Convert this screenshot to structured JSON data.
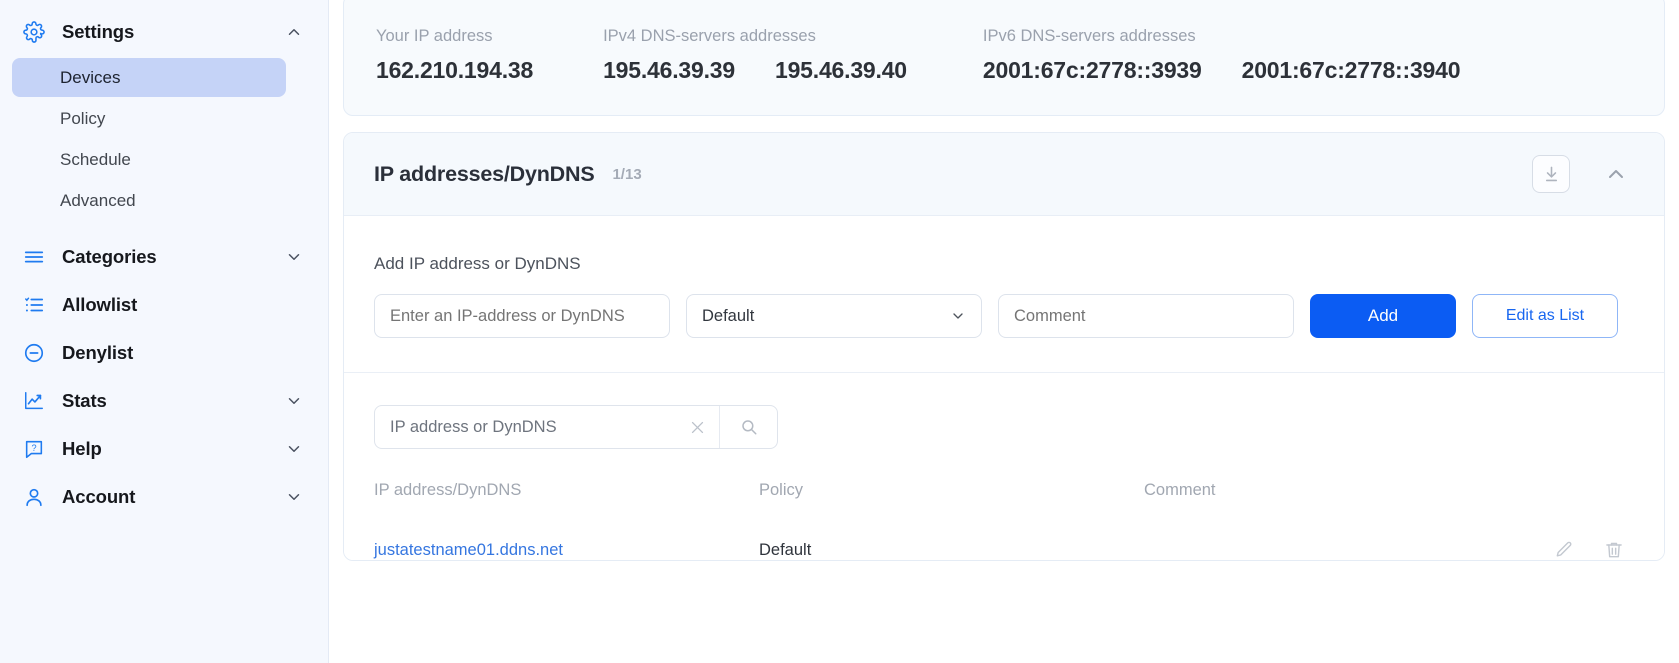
{
  "sidebar": {
    "groups": [
      {
        "label": "Settings",
        "icon": "gear-icon",
        "chevron": "chevron-up-icon",
        "expanded": true,
        "items": [
          {
            "label": "Devices",
            "active": true
          },
          {
            "label": "Policy",
            "active": false
          },
          {
            "label": "Schedule",
            "active": false
          },
          {
            "label": "Advanced",
            "active": false
          }
        ]
      },
      {
        "label": "Categories",
        "icon": "menu-lines-icon",
        "chevron": "chevron-down-icon",
        "expanded": false,
        "items": []
      },
      {
        "label": "Allowlist",
        "icon": "list-check-icon",
        "chevron": "",
        "expanded": false,
        "items": []
      },
      {
        "label": "Denylist",
        "icon": "minus-circle-icon",
        "chevron": "",
        "expanded": false,
        "items": []
      },
      {
        "label": "Stats",
        "icon": "chart-line-icon",
        "chevron": "chevron-down-icon",
        "expanded": false,
        "items": []
      },
      {
        "label": "Help",
        "icon": "help-chat-icon",
        "chevron": "chevron-down-icon",
        "expanded": false,
        "items": []
      },
      {
        "label": "Account",
        "icon": "user-icon",
        "chevron": "chevron-down-icon",
        "expanded": false,
        "items": []
      }
    ]
  },
  "ip_summary": {
    "your_ip": {
      "caption": "Your IP address",
      "value": "162.210.194.38"
    },
    "ipv4_dns": {
      "caption": "IPv4 DNS-servers addresses",
      "values": [
        "195.46.39.39",
        "195.46.39.40"
      ]
    },
    "ipv6_dns": {
      "caption": "IPv6 DNS-servers addresses",
      "values": [
        "2001:67c:2778::3939",
        "2001:67c:2778::3940"
      ]
    }
  },
  "panel": {
    "title": "IP addresses/DynDNS",
    "count": "1/13",
    "download_icon": "download-icon",
    "collapse_icon": "chevron-up-icon",
    "add_section_label": "Add IP address or DynDNS",
    "ip_input_placeholder": "Enter an IP-address or DynDNS",
    "ip_input_value": "",
    "policy_select_value": "Default",
    "comment_input_placeholder": "Comment",
    "comment_input_value": "",
    "add_button": "Add",
    "edit_as_list_button": "Edit as List",
    "search_placeholder": "IP address or DynDNS",
    "search_value": "",
    "clear_icon": "close-x-icon",
    "search_icon": "search-icon"
  },
  "table": {
    "columns": [
      "IP address/DynDNS",
      "Policy",
      "Comment"
    ],
    "rows": [
      {
        "ip": "justatestname01.ddns.net",
        "policy": "Default",
        "comment": "",
        "edit_icon": "pencil-icon",
        "delete_icon": "trash-icon"
      }
    ]
  },
  "colors": {
    "accent": "#0b5cf3",
    "link": "#3576e0",
    "sidebar_bg": "#f5f8fe",
    "active_item_bg": "#c5d3f7"
  }
}
